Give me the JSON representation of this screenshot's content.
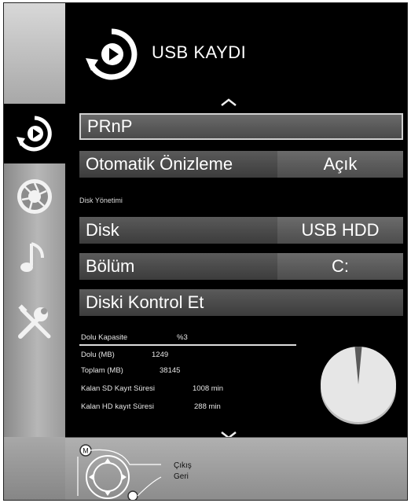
{
  "header": {
    "title": "USB KAYDI"
  },
  "sidebar": {
    "items": [
      {
        "icon": "record-icon",
        "selected": true
      },
      {
        "icon": "aperture-icon",
        "selected": false
      },
      {
        "icon": "music-note-icon",
        "selected": false
      },
      {
        "icon": "tools-icon",
        "selected": false
      }
    ]
  },
  "menu": {
    "prnp": {
      "label": "PRnP"
    },
    "auto_preview": {
      "label": "Otomatik Önizleme",
      "value": "Açık"
    },
    "section_label": "Disk Yönetimi",
    "disk": {
      "label": "Disk",
      "value": "USB HDD"
    },
    "partition": {
      "label": "Bölüm",
      "value": "C:"
    },
    "check_disk": {
      "label": "Diski Kontrol Et"
    }
  },
  "stats": {
    "full_capacity": {
      "label": "Dolu Kapasite",
      "value": "%3"
    },
    "full_mb": {
      "label": "Dolu (MB)",
      "value": "1249"
    },
    "total_mb": {
      "label": "Toplam (MB)",
      "value": "38145"
    },
    "remaining_sd": {
      "label": "Kalan SD Kayıt Süresi",
      "value": "1008 min"
    },
    "remaining_hd": {
      "label": "Kalan HD kayıt Süresi",
      "value": "288 min"
    },
    "used_fraction": 0.03
  },
  "footer": {
    "exit_label": "Çıkış",
    "back_label": "Geri",
    "menu_key_label": "M"
  },
  "colors": {
    "background": "#000000",
    "row": "#4a4a4a",
    "pie_free": "#e6e6e6",
    "pie_used": "#5a5a5a"
  }
}
